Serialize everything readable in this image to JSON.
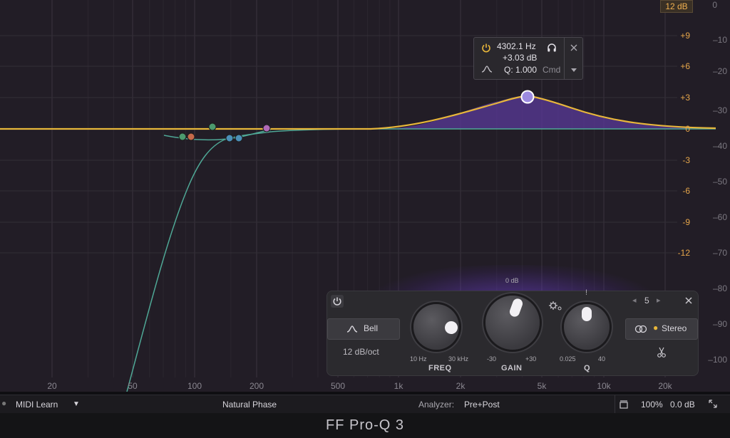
{
  "range_button": "12 dB",
  "range_top_value": "0",
  "gain_scale": [
    "+9",
    "+6",
    "+3",
    "0",
    "-3",
    "-6",
    "-9",
    "-12"
  ],
  "spectrum_scale": [
    "-10",
    "-20",
    "-30",
    "-40",
    "-50",
    "-60",
    "-70",
    "-80",
    "-90",
    "-100"
  ],
  "freq_labels": [
    "20",
    "50",
    "100",
    "200",
    "500",
    "1k",
    "2k",
    "5k",
    "10k",
    "20k"
  ],
  "tooltip": {
    "freq": "4302.1 Hz",
    "gain": "+3.03 dB",
    "q": "Q: 1.000",
    "modifier": "Cmd"
  },
  "band_panel": {
    "shape_label": "Bell",
    "slope_label": "12 dB/oct",
    "band_number": "5",
    "stereo_label": "Stereo",
    "freq": {
      "label": "FREQ",
      "min": "10 Hz",
      "max": "30 kHz"
    },
    "gain": {
      "label": "GAIN",
      "min": "-30",
      "max": "+30",
      "center": "0 dB"
    },
    "q": {
      "label": "Q",
      "min": "0.025",
      "max": "40"
    }
  },
  "status_bar": {
    "midi_learn": "MIDI Learn",
    "phase_mode": "Natural Phase",
    "analyzer_label": "Analyzer:",
    "analyzer_value": "Pre+Post",
    "zoom": "100%",
    "output_gain": "0.0 dB"
  },
  "footer_title": "FF Pro-Q 3",
  "colors": {
    "eq_curve": "#e8b73a",
    "filter_curve": "#4fa896",
    "band_fill": "#5a3a9a",
    "gain_scale_text": "#e6a64a",
    "background": "#221d26"
  },
  "icons": [
    "power-icon",
    "headphones-icon",
    "close-icon",
    "bell-shape-icon",
    "chevron-down-icon",
    "stereo-link-icon",
    "scissors-icon",
    "zoom-fit-icon",
    "resize-icon",
    "dynamic-gear-icon"
  ]
}
